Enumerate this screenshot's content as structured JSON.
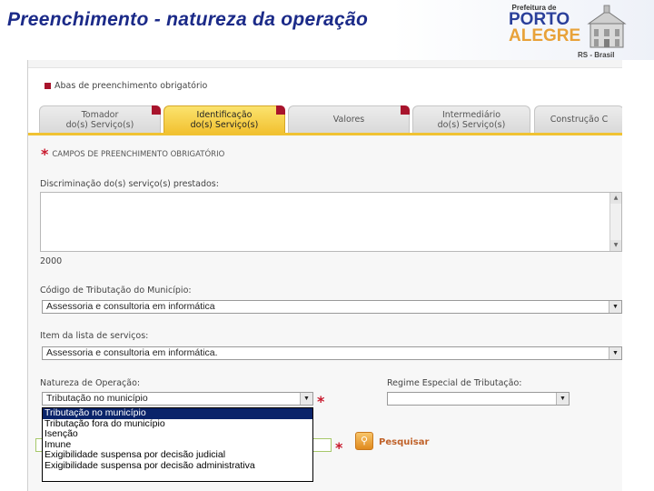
{
  "slide": {
    "title": "Preenchimento - natureza da operação",
    "logo_top": "Prefeitura de",
    "logo_mid": "PORTO",
    "logo_bottom": "ALEGRE",
    "region": "RS - Brasil"
  },
  "form": {
    "abas_label": "Abas de preenchimento obrigatório",
    "tabs": [
      {
        "line1": "Tomador",
        "line2": "do(s) Serviço(s)",
        "active": false
      },
      {
        "line1": "Identificação",
        "line2": "do(s) Serviço(s)",
        "active": true
      },
      {
        "line1": "Valores",
        "line2": "",
        "active": false
      },
      {
        "line1": "Intermediário",
        "line2": "do(s) Serviço(s)",
        "active": false
      },
      {
        "line1": "Construção C",
        "line2": "",
        "active": false
      }
    ],
    "required_note": "CAMPOS DE PREENCHIMENTO OBRIGATÓRIO",
    "discriminacao_label": "Discriminação do(s) serviço(s) prestados:",
    "char_count": "2000",
    "codigo_label": "Código de Tributação do Município:",
    "codigo_value": "Assessoria e consultoria em informática",
    "item_label": "Item da lista de serviços:",
    "item_value": "Assessoria e consultoria em informática.",
    "natureza_label": "Natureza de Operação:",
    "natureza_value": "Tributação no município",
    "regime_label": "Regime Especial de Tributação:",
    "regime_value": "",
    "natureza_options": [
      "Tributação no município",
      "Tributação fora do município",
      "Isenção",
      "Imune",
      "Exigibilidade suspensa por decisão judicial",
      "Exigibilidade suspensa por decisão administrativa"
    ],
    "selected_option_index": 0,
    "search_label": "Pesquisar"
  },
  "colors": {
    "title": "#1b2a88",
    "active_tab": "#f2c232",
    "required_star": "#c8182c",
    "dropdown_highlight": "#0a246a"
  }
}
